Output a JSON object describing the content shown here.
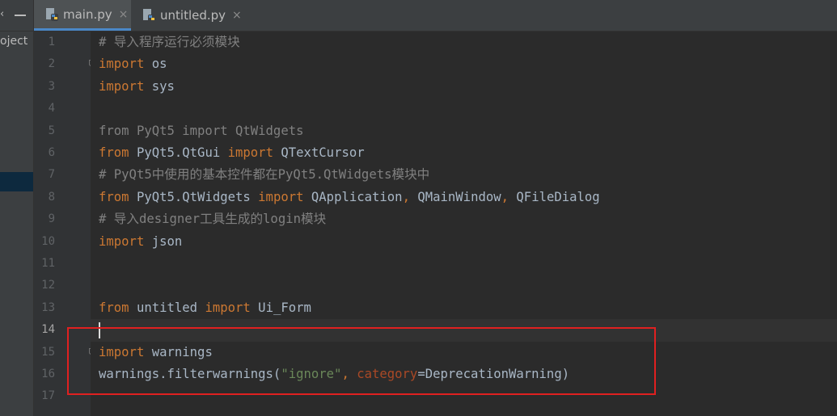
{
  "project_panel": {
    "label": "oject"
  },
  "tabs": [
    {
      "label": "main.py",
      "active": true
    },
    {
      "label": "untitled.py",
      "active": false
    }
  ],
  "tab_close_glyph": "×",
  "current_line": 14,
  "line_numbers": [
    "1",
    "2",
    "3",
    "4",
    "5",
    "6",
    "7",
    "8",
    "9",
    "10",
    "11",
    "12",
    "13",
    "14",
    "15",
    "16",
    "17"
  ],
  "code_lines": [
    {
      "tokens": [
        {
          "t": "# 导入程序运行必须模块",
          "c": "cm"
        }
      ]
    },
    {
      "tokens": [
        {
          "t": "import",
          "c": "kw"
        },
        {
          "t": " os",
          "c": "nm"
        }
      ]
    },
    {
      "tokens": [
        {
          "t": "import",
          "c": "kw"
        },
        {
          "t": " sys",
          "c": "nm"
        }
      ]
    },
    {
      "tokens": []
    },
    {
      "tokens": [
        {
          "t": "from PyQt5 import QtWidgets",
          "c": "cm"
        }
      ]
    },
    {
      "tokens": [
        {
          "t": "from",
          "c": "kw"
        },
        {
          "t": " PyQt5.QtGui ",
          "c": "nm"
        },
        {
          "t": "import",
          "c": "kw"
        },
        {
          "t": " QTextCursor",
          "c": "nm"
        }
      ]
    },
    {
      "tokens": [
        {
          "t": "# PyQt5中使用的基本控件都在PyQt5.QtWidgets模块中",
          "c": "cm"
        }
      ]
    },
    {
      "tokens": [
        {
          "t": "from",
          "c": "kw"
        },
        {
          "t": " PyQt5.QtWidgets ",
          "c": "nm"
        },
        {
          "t": "import",
          "c": "kw"
        },
        {
          "t": " QApplication",
          "c": "nm"
        },
        {
          "t": ",",
          "c": "kw"
        },
        {
          "t": " QMainWindow",
          "c": "nm"
        },
        {
          "t": ",",
          "c": "kw"
        },
        {
          "t": " QFileDialog",
          "c": "nm"
        }
      ]
    },
    {
      "tokens": [
        {
          "t": "# 导入designer工具生成的login模块",
          "c": "cm"
        }
      ]
    },
    {
      "tokens": [
        {
          "t": "import",
          "c": "kw"
        },
        {
          "t": " json",
          "c": "nm"
        }
      ]
    },
    {
      "tokens": []
    },
    {
      "tokens": []
    },
    {
      "tokens": [
        {
          "t": "from",
          "c": "kw"
        },
        {
          "t": " untitled ",
          "c": "nm"
        },
        {
          "t": "import",
          "c": "kw"
        },
        {
          "t": " Ui_Form",
          "c": "nm"
        }
      ]
    },
    {
      "tokens": []
    },
    {
      "tokens": [
        {
          "t": "import",
          "c": "kw"
        },
        {
          "t": " warnings",
          "c": "nm"
        }
      ]
    },
    {
      "tokens": [
        {
          "t": "warnings.filterwarnings(",
          "c": "nm"
        },
        {
          "t": "\"ignore\"",
          "c": "str"
        },
        {
          "t": ", ",
          "c": "kw"
        },
        {
          "t": "category",
          "c": "param"
        },
        {
          "t": "=DeprecationWarning)",
          "c": "nm"
        }
      ]
    },
    {
      "tokens": []
    }
  ],
  "colors": {
    "keyword": "#cc7832",
    "comment": "#808080",
    "string": "#6a8759",
    "param": "#aa4926",
    "text": "#a9b7c6",
    "highlight_box": "#e02020"
  }
}
